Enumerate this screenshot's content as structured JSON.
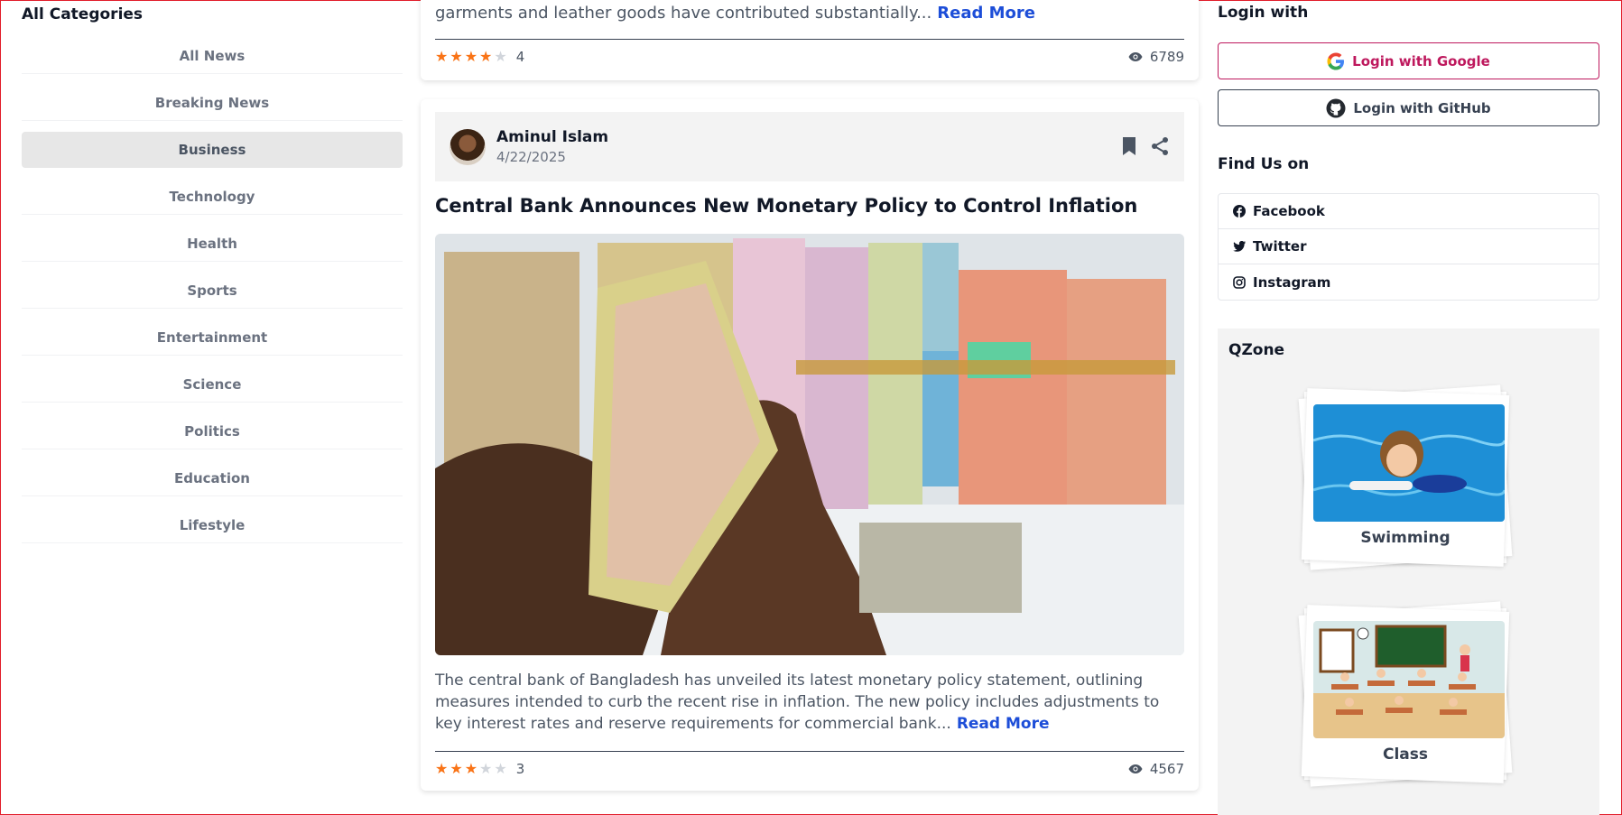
{
  "categories": {
    "heading": "All Categories",
    "items": [
      {
        "label": "All News"
      },
      {
        "label": "Breaking News"
      },
      {
        "label": "Business"
      },
      {
        "label": "Technology"
      },
      {
        "label": "Health"
      },
      {
        "label": "Sports"
      },
      {
        "label": "Entertainment"
      },
      {
        "label": "Science"
      },
      {
        "label": "Politics"
      },
      {
        "label": "Education"
      },
      {
        "label": "Lifestyle"
      }
    ],
    "active": "Business"
  },
  "prev_card": {
    "excerpt": "garments and leather goods have contributed substantially...",
    "read_more": "Read More",
    "rating": 4,
    "rating_label": "4",
    "views": "6789"
  },
  "card": {
    "author_name": "Aminul Islam",
    "date": "4/22/2025",
    "title": "Central Bank Announces New Monetary Policy to Control Inflation",
    "excerpt": "The central bank of Bangladesh has unveiled its latest monetary policy statement, outlining measures intended to curb the recent rise in inflation. The new policy includes adjustments to key interest rates and reserve requirements for commercial bank...",
    "read_more": "Read More",
    "rating": 3,
    "rating_label": "3",
    "views": "4567"
  },
  "login": {
    "heading": "Login with",
    "google": "Login with Google",
    "github": "Login with GitHub"
  },
  "find_us": {
    "heading": "Find Us on",
    "items": [
      {
        "label": "Facebook",
        "icon": "facebook-icon"
      },
      {
        "label": "Twitter",
        "icon": "twitter-icon"
      },
      {
        "label": "Instagram",
        "icon": "instagram-icon"
      }
    ]
  },
  "qzone": {
    "heading": "QZone",
    "items": [
      {
        "label": "Swimming"
      },
      {
        "label": "Class"
      }
    ]
  },
  "colors": {
    "accent": "#1d4ed8",
    "star": "#f97316",
    "google": "#be185d"
  }
}
